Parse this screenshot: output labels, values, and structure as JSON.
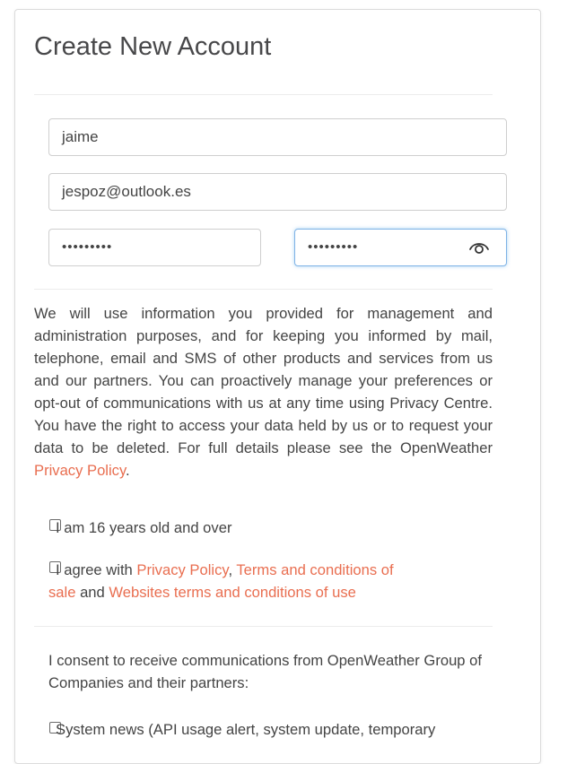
{
  "title": "Create New Account",
  "form": {
    "username": "jaime",
    "email": "jespoz@outlook.es",
    "password": "•••••••••",
    "password_repeat": "•••••••••"
  },
  "privacy": {
    "text": "We will use information you provided for management and administration purposes, and for keeping you informed by mail, telephone, email and SMS of other products and services from us and our partners. You can proactively manage your preferences or opt-out of communications with us at any time using Privacy Centre. You have the right to access your data held by us or to request your data to be deleted. For full details please see the OpenWeather ",
    "link": "Privacy Policy",
    "end": "."
  },
  "age_check": {
    "label": "I am 16 years old and over",
    "checked": false
  },
  "agree_check": {
    "prefix": "I agree with ",
    "link1": "Privacy Policy",
    "sep": ", ",
    "link2_line1": "Terms and conditions of",
    "link2_line2": "sale",
    "and": " and ",
    "link3": "Websites terms and conditions of use",
    "checked": false
  },
  "consent": {
    "text": "I consent to receive communications from OpenWeather Group of Companies and their partners:"
  },
  "system_news": {
    "label": "System news (API usage alert, system update, temporary",
    "checked": false
  },
  "colors": {
    "link": "#e96e50",
    "focus_border": "#7fb3e6"
  },
  "icons": {
    "password_toggle": "eye-icon"
  }
}
